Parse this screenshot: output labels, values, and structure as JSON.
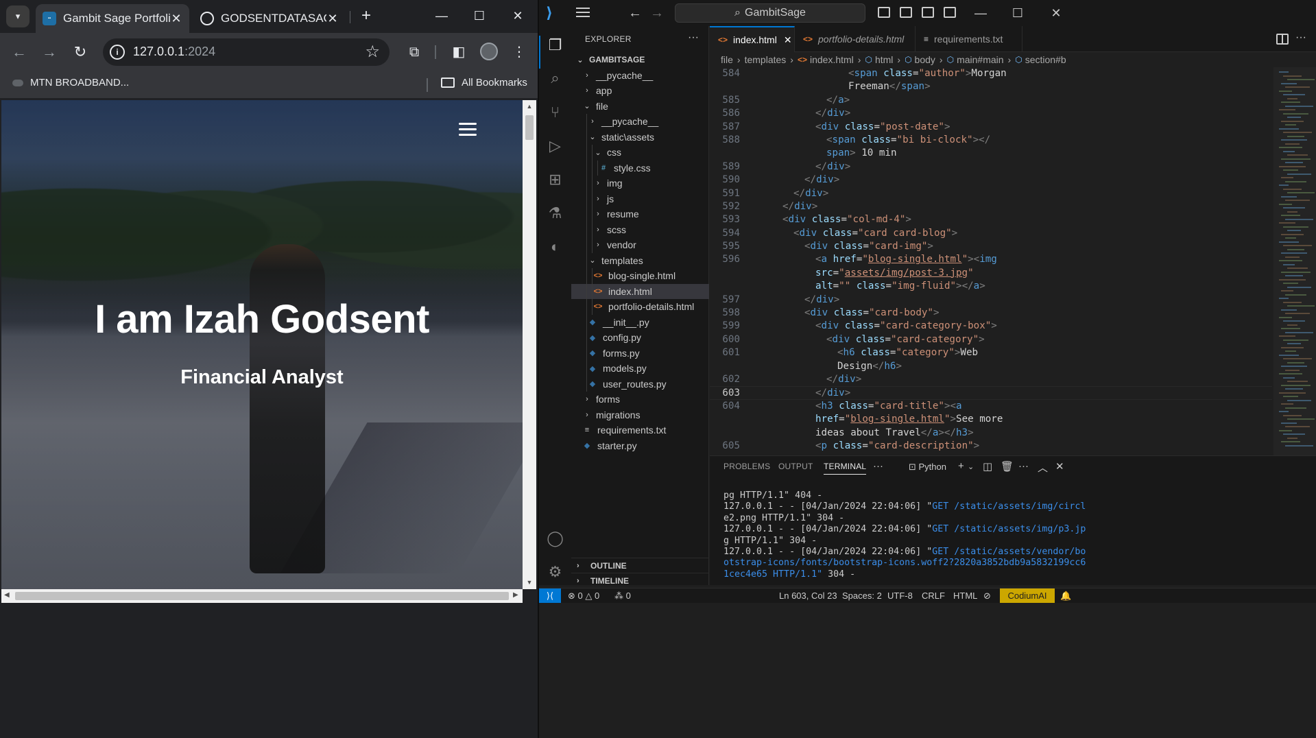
{
  "browser": {
    "tabs": [
      {
        "title": "Gambit Sage Portfolio",
        "active": true
      },
      {
        "title": "GODSENTDATASAGE.p",
        "active": false
      }
    ],
    "url_host": "127.0.0.1",
    "url_port": ":2024",
    "bookmark_item": "MTN BROADBAND...",
    "all_bookmarks": "All Bookmarks",
    "page": {
      "hero_title": "I am Izah Godsent",
      "hero_subtitle": "Financial Analyst"
    }
  },
  "vscode": {
    "search_text": "GambitSage",
    "explorer": {
      "header": "EXPLORER",
      "root": "GAMBITSAGE",
      "items": [
        {
          "label": "__pycache__",
          "type": "folder",
          "open": false,
          "depth": 0
        },
        {
          "label": "app",
          "type": "folder",
          "open": false,
          "depth": 0
        },
        {
          "label": "file",
          "type": "folder",
          "open": true,
          "depth": 0
        },
        {
          "label": "__pycache__",
          "type": "folder",
          "open": false,
          "depth": 1
        },
        {
          "label": "static\\assets",
          "type": "folder",
          "open": true,
          "depth": 1
        },
        {
          "label": "css",
          "type": "folder",
          "open": true,
          "depth": 2
        },
        {
          "label": "style.css",
          "type": "css",
          "depth": 3
        },
        {
          "label": "img",
          "type": "folder",
          "open": false,
          "depth": 2
        },
        {
          "label": "js",
          "type": "folder",
          "open": false,
          "depth": 2
        },
        {
          "label": "resume",
          "type": "folder",
          "open": false,
          "depth": 2
        },
        {
          "label": "scss",
          "type": "folder",
          "open": false,
          "depth": 2
        },
        {
          "label": "vendor",
          "type": "folder",
          "open": false,
          "depth": 2
        },
        {
          "label": "templates",
          "type": "folder",
          "open": true,
          "depth": 1
        },
        {
          "label": "blog-single.html",
          "type": "html",
          "depth": 2
        },
        {
          "label": "index.html",
          "type": "html",
          "depth": 2,
          "selected": true
        },
        {
          "label": "portfolio-details.html",
          "type": "html",
          "depth": 2
        },
        {
          "label": "__init__.py",
          "type": "py",
          "depth": 1
        },
        {
          "label": "config.py",
          "type": "py",
          "depth": 1
        },
        {
          "label": "forms.py",
          "type": "py",
          "depth": 1
        },
        {
          "label": "models.py",
          "type": "py",
          "depth": 1
        },
        {
          "label": "user_routes.py",
          "type": "py",
          "depth": 1
        },
        {
          "label": "forms",
          "type": "folder",
          "open": false,
          "depth": 0
        },
        {
          "label": "migrations",
          "type": "folder",
          "open": false,
          "depth": 0
        },
        {
          "label": "requirements.txt",
          "type": "txt",
          "depth": 0
        },
        {
          "label": "starter.py",
          "type": "py",
          "depth": 0
        }
      ],
      "outline": "OUTLINE",
      "timeline": "TIMELINE"
    },
    "tabs": [
      {
        "label": "index.html",
        "active": true,
        "icon": "<>"
      },
      {
        "label": "portfolio-details.html",
        "active": false,
        "icon": "<>",
        "italic": true
      },
      {
        "label": "requirements.txt",
        "active": false,
        "icon": "≡"
      }
    ],
    "breadcrumb": [
      "file",
      "templates",
      "index.html",
      "html",
      "body",
      "main#main",
      "section#b"
    ],
    "code_lines": [
      {
        "n": "584",
        "html": "<span class='tag'>&lt;</span><span class='tn'>span</span> <span class='an'>class</span><span class='tx'>=</span><span class='av'>\"author\"</span><span class='tag'>&gt;</span><span class='tx'>Morgan</span>",
        "indent": 10
      },
      {
        "n": "",
        "html": "<span class='tx'>Freeman</span><span class='tag'>&lt;/</span><span class='tn'>span</span><span class='tag'>&gt;</span>",
        "indent": 10
      },
      {
        "n": "585",
        "html": "<span class='tag'>&lt;/</span><span class='tn'>a</span><span class='tag'>&gt;</span>",
        "indent": 8
      },
      {
        "n": "586",
        "html": "<span class='tag'>&lt;/</span><span class='tn'>div</span><span class='tag'>&gt;</span>",
        "indent": 7
      },
      {
        "n": "587",
        "html": "<span class='tag'>&lt;</span><span class='tn'>div</span> <span class='an'>class</span><span class='tx'>=</span><span class='av'>\"post-date\"</span><span class='tag'>&gt;</span>",
        "indent": 7
      },
      {
        "n": "588",
        "html": "<span class='tag'>&lt;</span><span class='tn'>span</span> <span class='an'>class</span><span class='tx'>=</span><span class='av'>\"bi bi-clock\"</span><span class='tag'>&gt;&lt;/</span>",
        "indent": 8
      },
      {
        "n": "",
        "html": "<span class='tn'>span</span><span class='tag'>&gt;</span><span class='tx'> 10 min</span>",
        "indent": 8
      },
      {
        "n": "589",
        "html": "<span class='tag'>&lt;/</span><span class='tn'>div</span><span class='tag'>&gt;</span>",
        "indent": 7
      },
      {
        "n": "590",
        "html": "<span class='tag'>&lt;/</span><span class='tn'>div</span><span class='tag'>&gt;</span>",
        "indent": 6
      },
      {
        "n": "591",
        "html": "<span class='tag'>&lt;/</span><span class='tn'>div</span><span class='tag'>&gt;</span>",
        "indent": 5
      },
      {
        "n": "592",
        "html": "<span class='tag'>&lt;/</span><span class='tn'>div</span><span class='tag'>&gt;</span>",
        "indent": 4
      },
      {
        "n": "593",
        "html": "<span class='tag'>&lt;</span><span class='tn'>div</span> <span class='an'>class</span><span class='tx'>=</span><span class='av'>\"col-md-4\"</span><span class='tag'>&gt;</span>",
        "indent": 4
      },
      {
        "n": "594",
        "html": "<span class='tag'>&lt;</span><span class='tn'>div</span> <span class='an'>class</span><span class='tx'>=</span><span class='av'>\"card card-blog\"</span><span class='tag'>&gt;</span>",
        "indent": 5
      },
      {
        "n": "595",
        "html": "<span class='tag'>&lt;</span><span class='tn'>div</span> <span class='an'>class</span><span class='tx'>=</span><span class='av'>\"card-img\"</span><span class='tag'>&gt;</span>",
        "indent": 6
      },
      {
        "n": "596",
        "html": "<span class='tag'>&lt;</span><span class='tn'>a</span> <span class='an'>href</span><span class='tx'>=</span><span class='av'>\"<span class='u'>blog-single.html</span>\"</span><span class='tag'>&gt;&lt;</span><span class='tn'>img</span>",
        "indent": 7
      },
      {
        "n": "",
        "html": "<span class='an'>src</span><span class='tx'>=</span><span class='av'>\"<span class='u'>assets/img/post-3.jpg</span>\"</span>",
        "indent": 7
      },
      {
        "n": "",
        "html": "<span class='an'>alt</span><span class='tx'>=</span><span class='av'>\"\"</span> <span class='an'>class</span><span class='tx'>=</span><span class='av'>\"img-fluid\"</span><span class='tag'>&gt;&lt;/</span><span class='tn'>a</span><span class='tag'>&gt;</span>",
        "indent": 7
      },
      {
        "n": "597",
        "html": "<span class='tag'>&lt;/</span><span class='tn'>div</span><span class='tag'>&gt;</span>",
        "indent": 6
      },
      {
        "n": "598",
        "html": "<span class='tag'>&lt;</span><span class='tn'>div</span> <span class='an'>class</span><span class='tx'>=</span><span class='av'>\"card-body\"</span><span class='tag'>&gt;</span>",
        "indent": 6
      },
      {
        "n": "599",
        "html": "<span class='tag'>&lt;</span><span class='tn'>div</span> <span class='an'>class</span><span class='tx'>=</span><span class='av'>\"card-category-box\"</span><span class='tag'>&gt;</span>",
        "indent": 7
      },
      {
        "n": "600",
        "html": "<span class='tag'>&lt;</span><span class='tn'>div</span> <span class='an'>class</span><span class='tx'>=</span><span class='av'>\"card-category\"</span><span class='tag'>&gt;</span>",
        "indent": 8
      },
      {
        "n": "601",
        "html": "<span class='tag'>&lt;</span><span class='tn'>h6</span> <span class='an'>class</span><span class='tx'>=</span><span class='av'>\"category\"</span><span class='tag'>&gt;</span><span class='tx'>Web</span>",
        "indent": 9
      },
      {
        "n": "",
        "html": "<span class='tx'>Design</span><span class='tag'>&lt;/</span><span class='tn'>h6</span><span class='tag'>&gt;</span>",
        "indent": 9
      },
      {
        "n": "602",
        "html": "<span class='tag'>&lt;/</span><span class='tn'>div</span><span class='tag'>&gt;</span>",
        "indent": 8
      },
      {
        "n": "603",
        "html": "<span class='tag'>&lt;/</span><span class='tn'>div</span><span class='tag'>&gt;</span>",
        "indent": 7,
        "current": true
      },
      {
        "n": "604",
        "html": "<span class='tag'>&lt;</span><span class='tn'>h3</span> <span class='an'>class</span><span class='tx'>=</span><span class='av'>\"card-title\"</span><span class='tag'>&gt;&lt;</span><span class='tn'>a</span>",
        "indent": 7
      },
      {
        "n": "",
        "html": "<span class='an'>href</span><span class='tx'>=</span><span class='av'>\"<span class='u'>blog-single.html</span>\"</span><span class='tag'>&gt;</span><span class='tx'>See more</span>",
        "indent": 7
      },
      {
        "n": "",
        "html": "<span class='tx'>ideas about Travel</span><span class='tag'>&lt;/</span><span class='tn'>a</span><span class='tag'>&gt;&lt;/</span><span class='tn'>h3</span><span class='tag'>&gt;</span>",
        "indent": 7
      },
      {
        "n": "605",
        "html": "<span class='tag'>&lt;</span><span class='tn'>p</span> <span class='an'>class</span><span class='tx'>=</span><span class='av'>\"card-description\"</span><span class='tag'>&gt;</span>",
        "indent": 7
      }
    ],
    "panel": {
      "tabs": [
        "PROBLEMS",
        "OUTPUT",
        "TERMINAL"
      ],
      "active_tab": "TERMINAL",
      "shell": "Python",
      "terminal_lines": [
        {
          "text": "pg HTTP/1.1\" 404 -",
          "blue": ""
        },
        {
          "pre": "127.0.0.1 - - [04/Jan/2024 22:04:06] \"",
          "blue": "GET /static/assets/img/circl",
          "post": ""
        },
        {
          "pre": "e2.png HTTP/1.1\"",
          "blue": "",
          "post": " 304 -"
        },
        {
          "pre": "127.0.0.1 - - [04/Jan/2024 22:04:06] \"",
          "blue": "GET /static/assets/img/p3.jp",
          "post": ""
        },
        {
          "pre": "g HTTP/1.1\"",
          "blue": "",
          "post": " 304 -"
        },
        {
          "pre": "127.0.0.1 - - [04/Jan/2024 22:04:06] \"",
          "blue": "GET /static/assets/vendor/bo",
          "post": ""
        },
        {
          "pre": "",
          "blue": "otstrap-icons/fonts/bootstrap-icons.woff2?2820a3852bdb9a5832199cc6",
          "post": ""
        },
        {
          "pre": "",
          "blue": "1cec4e65 HTTP/1.1\"",
          "post": " 304 -"
        }
      ]
    },
    "status": {
      "errors": "0",
      "warnings": "0",
      "ports": "0",
      "cursor": "Ln 603, Col 23",
      "spaces": "Spaces: 2",
      "encoding": "UTF-8",
      "eol": "CRLF",
      "language": "HTML",
      "codium": "CodiumAI"
    }
  }
}
